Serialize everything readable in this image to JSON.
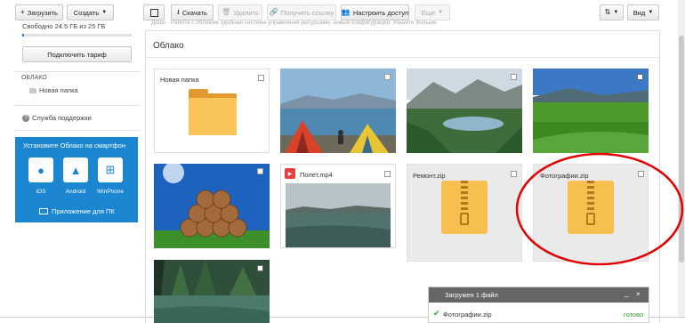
{
  "toolbar": {
    "upload": "Загрузить",
    "create": "Создать",
    "download": "Скачать",
    "delete": "Удалить",
    "get_link": "Получить ссылку",
    "access": "Настроить доступ",
    "more": "Еще",
    "view": "Вид"
  },
  "sidebar": {
    "storage": "Свободно 24.5 ГБ из 25 ГБ",
    "storage_used_percent": 2,
    "plan_button": "Подключить тариф",
    "section_title": "ОБЛАКО",
    "folder": "Новая папка",
    "support": "Служба поддержки",
    "promo_title": "Установите Облако на смартфон",
    "stores": [
      "iOS",
      "Android",
      "WinPhone"
    ],
    "pc_app": "Приложение для ПК"
  },
  "banner_text": "Дашк   ·   Работа с облаком Удобная система управления ресурсами, новые конфигурации. Узнайте больше",
  "main": {
    "title": "Облако",
    "items": [
      {
        "name": "Новая папка",
        "type": "folder"
      },
      {
        "name": "",
        "type": "image"
      },
      {
        "name": "",
        "type": "image"
      },
      {
        "name": "",
        "type": "image"
      },
      {
        "name": "",
        "type": "image"
      },
      {
        "name": "Полет.mp4",
        "type": "video"
      },
      {
        "name": "Ремонт.zip",
        "type": "zip"
      },
      {
        "name": "Фотографии.zip",
        "type": "zip"
      },
      {
        "name": "",
        "type": "image"
      }
    ]
  },
  "upload_panel": {
    "title": "Загружен 1 файл",
    "file": "Фотографии.zip",
    "status": "готово"
  },
  "colors": {
    "accent_blue": "#1c86d0",
    "folder_yellow": "#f7bf50",
    "annotation_red": "#e00000",
    "status_green": "#2e9e2e"
  }
}
